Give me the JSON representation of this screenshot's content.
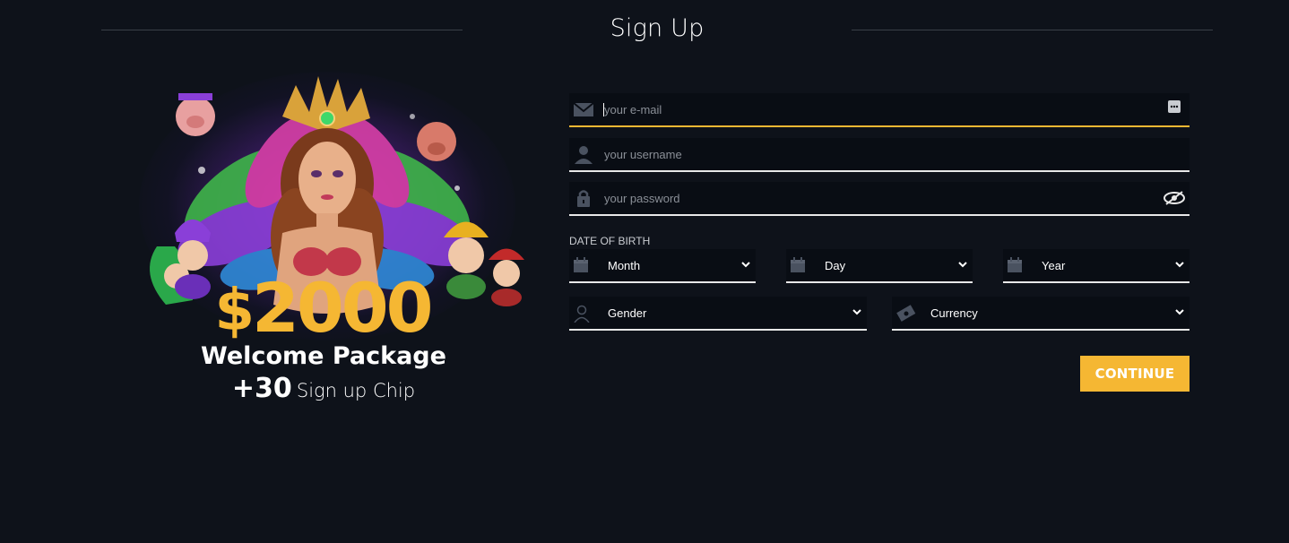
{
  "header": {
    "title": "Sign Up"
  },
  "promo": {
    "currency": "$",
    "amount": "2000",
    "welcome": "Welcome Package",
    "chip_amount": "+30",
    "chip_text": "Sign up Chip"
  },
  "form": {
    "email_placeholder": "your e-mail",
    "username_placeholder": "your username",
    "password_placeholder": "your password",
    "dob_label": "DATE OF BIRTH",
    "month": "Month",
    "day": "Day",
    "year": "Year",
    "gender": "Gender",
    "currency": "Currency",
    "continue_label": "CONTINUE"
  },
  "colors": {
    "accent": "#f5b733",
    "background": "#0e121a",
    "field_bg": "#090d14"
  }
}
